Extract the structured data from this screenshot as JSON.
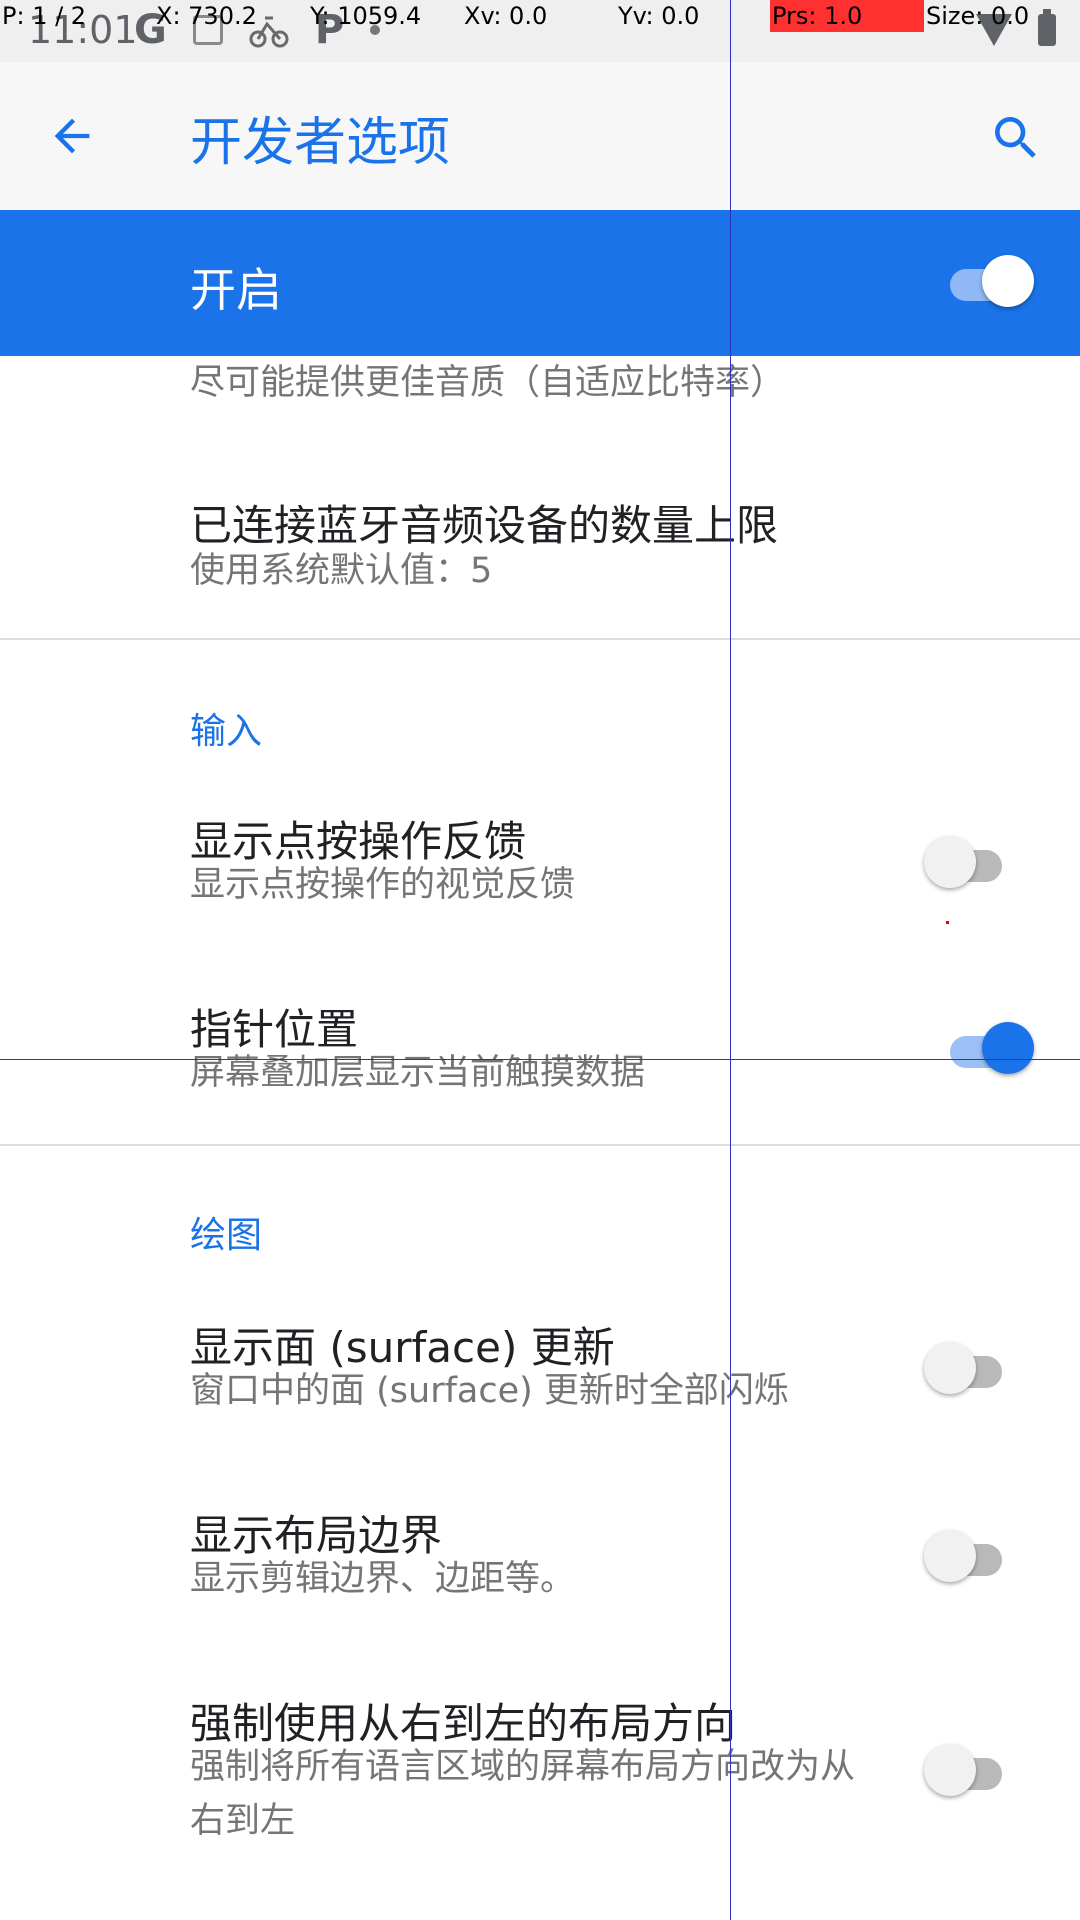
{
  "status_bar": {
    "time": "11:01",
    "icons": [
      "google-icon",
      "notification-box-icon",
      "bike-icon",
      "parking-icon",
      "dot-icon"
    ],
    "right_icons": [
      "wifi-icon",
      "battery-icon"
    ]
  },
  "pointer_info": {
    "p": "P: 1 / 2",
    "x": "X: 730.2",
    "y": "Y: 1059.4",
    "xv": "Xv: 0.0",
    "yv": "Yv: 0.0",
    "prs": "Prs: 1.0",
    "size": "Size: 0.0"
  },
  "app_bar": {
    "title": "开发者选项"
  },
  "master": {
    "label": "开启",
    "enabled": true
  },
  "items": {
    "audio_quality_sub": "尽可能提供更佳音质（自适应比特率）",
    "bt_limit_title": "已连接蓝牙音频设备的数量上限",
    "bt_limit_sub": "使用系统默认值：5",
    "input_category": "输入",
    "show_taps_title": "显示点按操作反馈",
    "show_taps_sub": "显示点按操作的视觉反馈",
    "pointer_location_title": "指针位置",
    "pointer_location_sub": "屏幕叠加层显示当前触摸数据",
    "drawing_category": "绘图",
    "surface_updates_title": "显示面 (surface) 更新",
    "surface_updates_sub": "窗口中的面 (surface) 更新时全部闪烁",
    "layout_bounds_title": "显示布局边界",
    "layout_bounds_sub": "显示剪辑边界、边距等。",
    "rtl_title": "强制使用从右到左的布局方向",
    "rtl_sub": "强制将所有语言区域的屏幕布局方向改为从右到左"
  },
  "colors": {
    "accent": "#1a73e8",
    "master_bar": "#1a73e8"
  }
}
